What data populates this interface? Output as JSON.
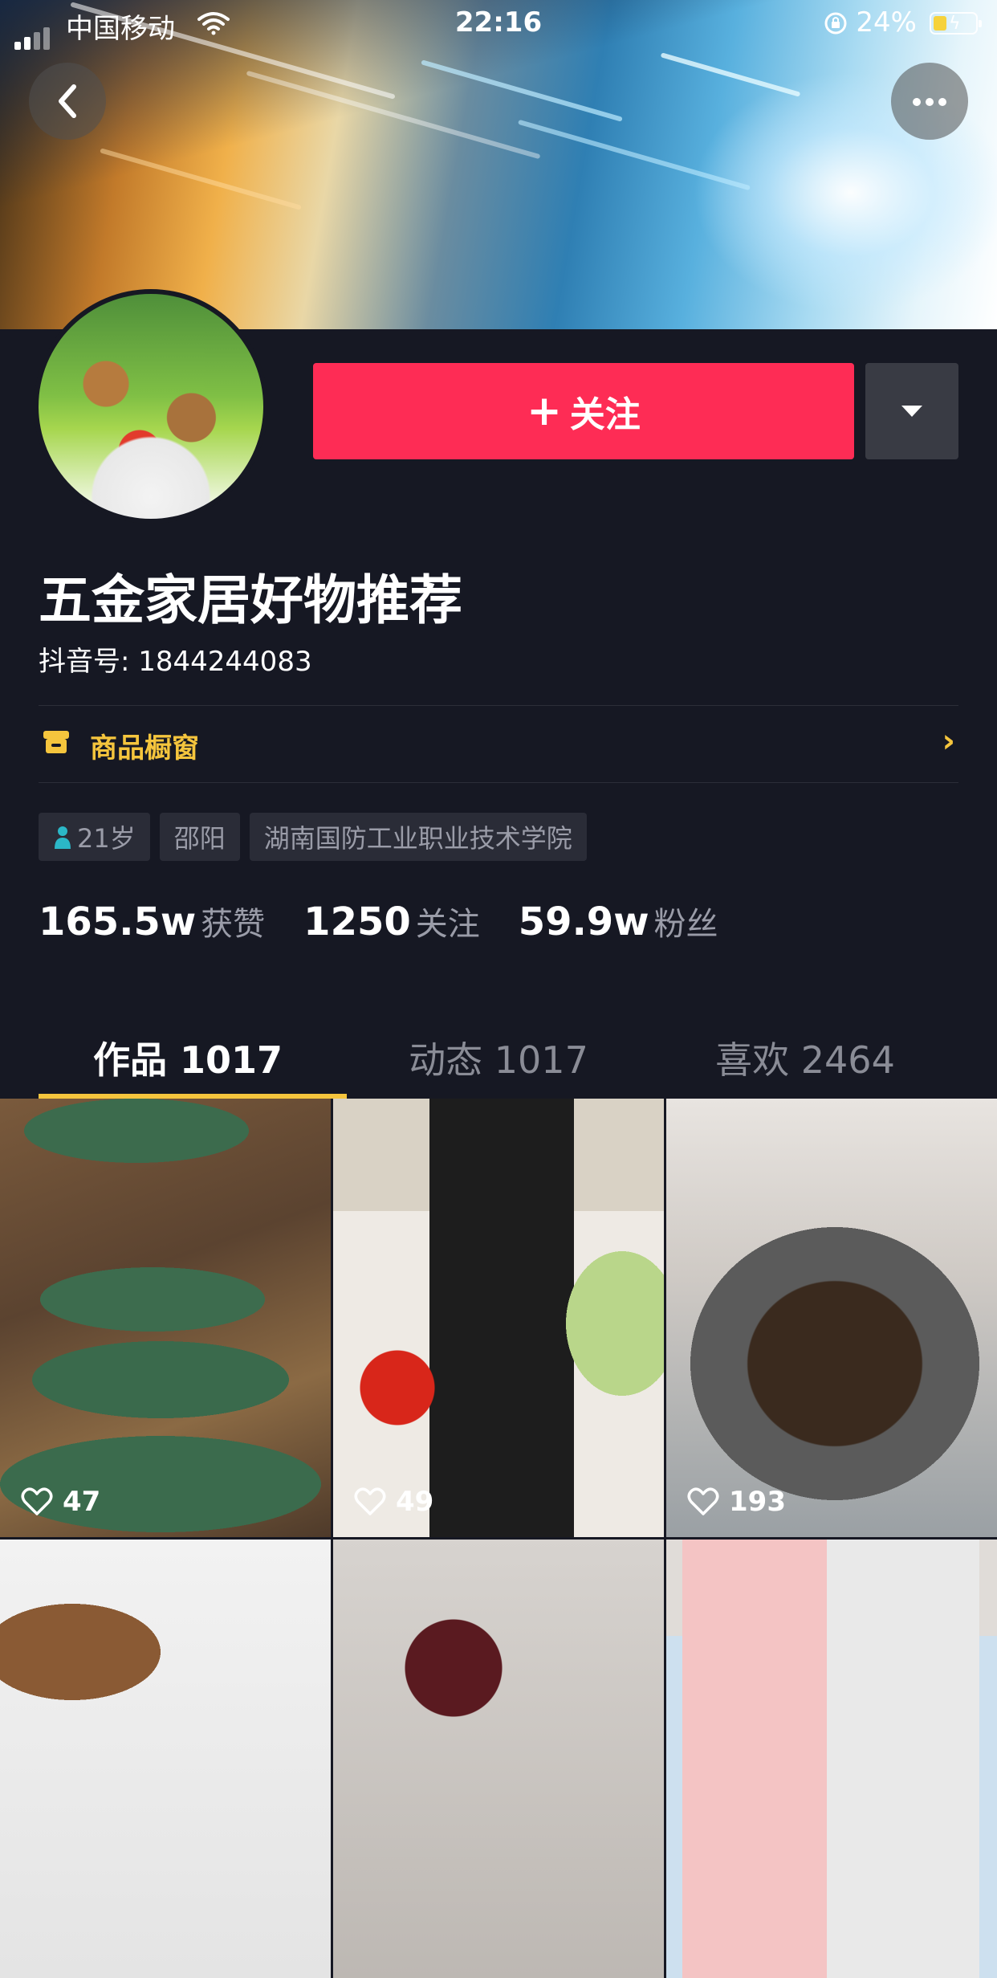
{
  "status_bar": {
    "carrier": "中国移动",
    "time": "22:16",
    "battery": "24%"
  },
  "profile": {
    "follow_label": "关注",
    "name": "五金家居好物推荐",
    "douyin_id": "抖音号: 1844244083",
    "shop_window": "商品橱窗",
    "tags": [
      "21岁",
      "邵阳",
      "湖南国防工业职业技术学院"
    ],
    "stats": [
      {
        "value": "165.5w",
        "label": "获赞"
      },
      {
        "value": "1250",
        "label": "关注"
      },
      {
        "value": "59.9w",
        "label": "粉丝"
      }
    ]
  },
  "tabs": [
    {
      "label": "作品 1017",
      "active": true
    },
    {
      "label": "动态 1017",
      "active": false
    },
    {
      "label": "喜欢 2464",
      "active": false
    }
  ],
  "videos": [
    {
      "likes": "47"
    },
    {
      "likes": "49"
    },
    {
      "likes": "193"
    },
    {
      "likes": ""
    },
    {
      "likes": ""
    },
    {
      "likes": ""
    }
  ],
  "colors": {
    "background": "#161823",
    "follow_button": "#fe2c55",
    "accent_yellow": "#f5c53d",
    "muted_text": "#9a9ca8"
  },
  "icons": [
    "back-icon",
    "more-icon",
    "dropdown-icon",
    "shop-icon",
    "chevron-right-icon",
    "person-icon",
    "heart-icon"
  ]
}
